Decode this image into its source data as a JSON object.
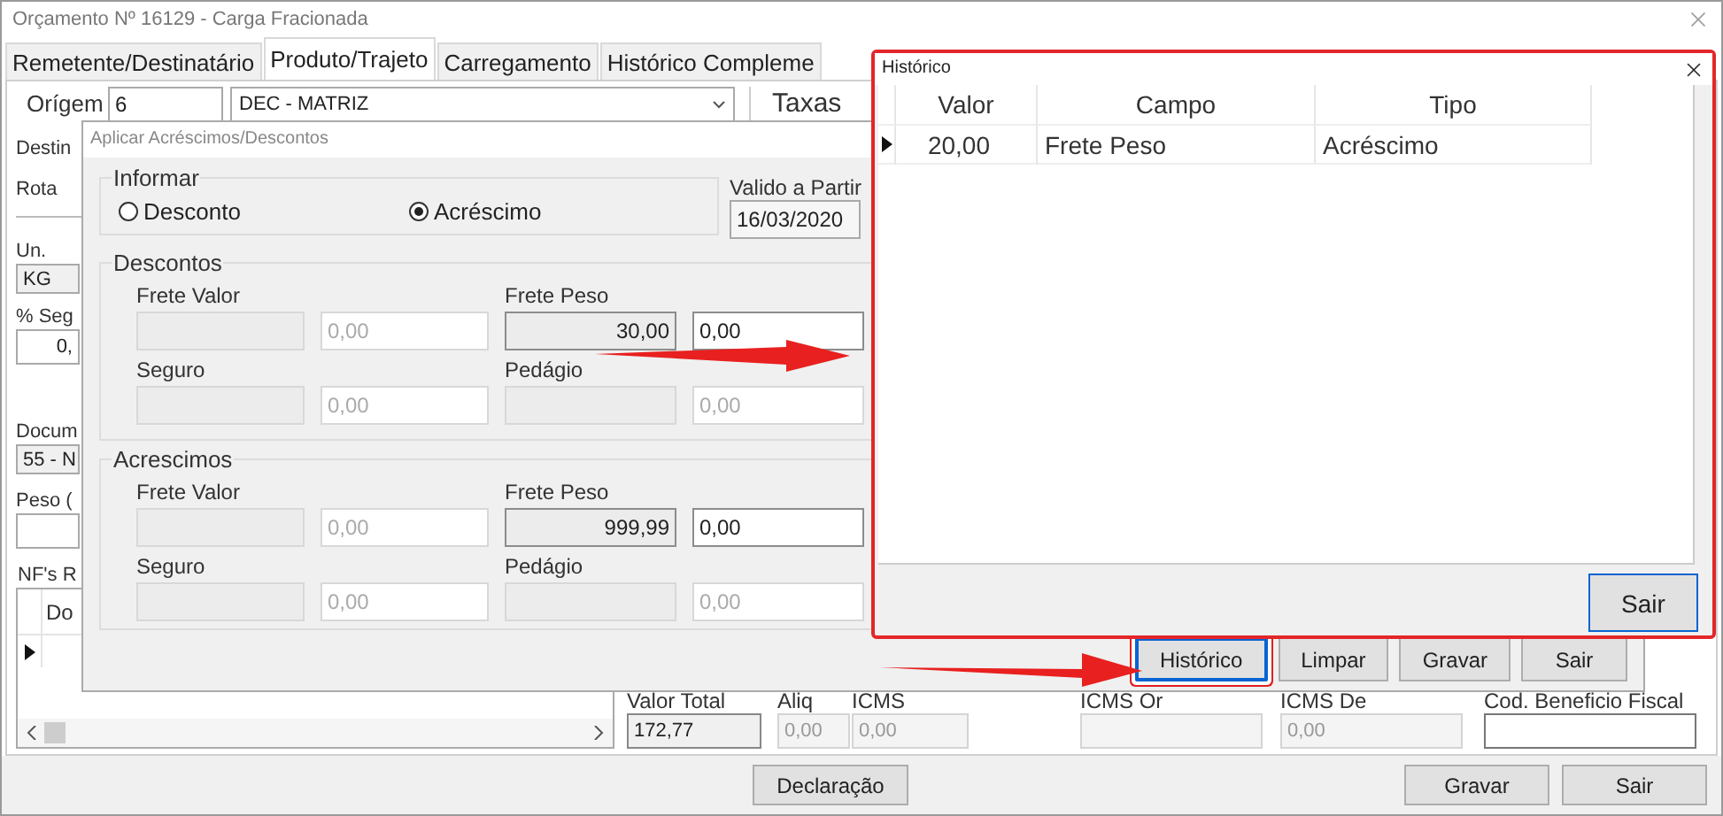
{
  "window": {
    "title": "Orçamento Nº 16129 - Carga Fracionada"
  },
  "tabs": [
    {
      "label": "Remetente/Destinatário",
      "selected": false
    },
    {
      "label": "Produto/Trajeto",
      "selected": true
    },
    {
      "label": "Carregamento",
      "selected": false
    },
    {
      "label": "Histórico Compleme",
      "selected": false
    }
  ],
  "form": {
    "origem": {
      "label": "Orígem",
      "code": "6",
      "name": "DEC - MATRIZ"
    },
    "taxas_label": "Taxas",
    "labels": [
      "Destin",
      "Rota"
    ],
    "left_fields": [
      {
        "label": "Un.",
        "value": "KG",
        "kind": "select"
      },
      {
        "label": "% Seg",
        "value": "0,",
        "kind": "number"
      },
      {
        "label": "Docum",
        "value": "55 - N",
        "kind": "select"
      },
      {
        "label": "Peso (",
        "kind": "number"
      }
    ],
    "nf_grid": {
      "label": "NF's R",
      "columns": [
        "Do"
      ],
      "rows": [
        {
          "selected": true
        }
      ]
    },
    "totals": [
      {
        "label": "Valor Total",
        "value": "172,77",
        "kind": "readonly"
      },
      {
        "label": "Aliq",
        "value": "0,00",
        "kind": "disabled"
      },
      {
        "label": "ICMS",
        "value": "0,00",
        "kind": "disabled"
      },
      {
        "label": "ICMS Or",
        "kind": "disabled"
      },
      {
        "label": "ICMS De",
        "value": "0,00",
        "kind": "disabled"
      },
      {
        "label": "Cod. Beneficio Fiscal",
        "kind": "editable"
      }
    ]
  },
  "footer": {
    "left": [
      "Declaração"
    ],
    "right": [
      "Gravar",
      "Sair"
    ]
  },
  "ajuste_dialog": {
    "title": "Aplicar Acréscimos/Descontos",
    "informar": {
      "label": "Informar",
      "options": [
        {
          "label": "Desconto",
          "selected": false
        },
        {
          "label": "Acréscimo",
          "selected": true
        }
      ]
    },
    "valid_from": {
      "label": "Valido a Partir",
      "value": "16/03/2020"
    },
    "groups": [
      {
        "label": "Descontos",
        "fields": [
          {
            "label": "Frete Valor",
            "value": "0,00",
            "enabled": false
          },
          {
            "label": "Frete Peso",
            "base": "30,00",
            "value": "0,00",
            "enabled": true
          },
          {
            "label": "Seguro",
            "value": "0,00",
            "enabled": false
          },
          {
            "label": "Pedágio",
            "value": "0,00",
            "enabled": false
          }
        ]
      },
      {
        "label": "Acrescimos",
        "fields": [
          {
            "label": "Frete Valor",
            "value": "0,00",
            "enabled": false
          },
          {
            "label": "Frete Peso",
            "base": "999,99",
            "value": "0,00",
            "enabled": true
          },
          {
            "label": "Seguro",
            "value": "0,00",
            "enabled": false
          },
          {
            "label": "Pedágio",
            "value": "0,00",
            "enabled": false
          }
        ]
      }
    ],
    "buttons": [
      {
        "label": "Histórico",
        "focused": true,
        "highlighted": true
      },
      {
        "label": "Limpar",
        "focused": false,
        "highlighted": false
      },
      {
        "label": "Gravar",
        "focused": false,
        "highlighted": false
      },
      {
        "label": "Sair",
        "focused": false,
        "highlighted": false
      }
    ]
  },
  "history_dialog": {
    "title": "Histórico",
    "columns": [
      "Valor",
      "Campo",
      "Tipo"
    ],
    "rows": [
      {
        "cells": [
          "20,00",
          "Frete Peso",
          "Acréscimo"
        ],
        "selected": true
      }
    ],
    "button": {
      "label": "Sair",
      "focused": true
    }
  }
}
